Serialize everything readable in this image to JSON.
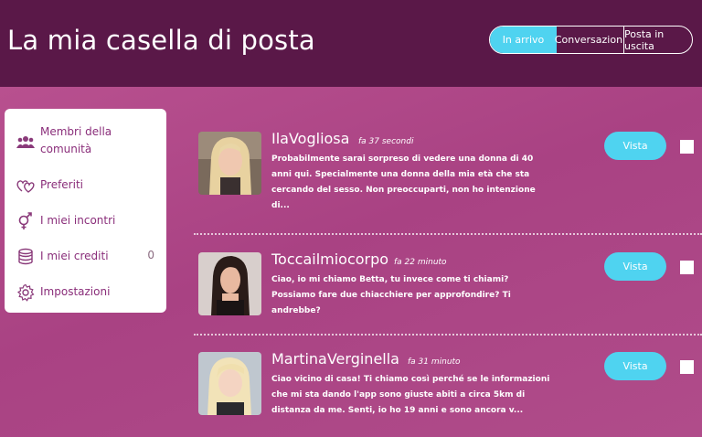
{
  "header": {
    "title": "La mia casella di posta",
    "tabs": [
      "In arrivo",
      "Conversazioni",
      "Posta in uscita"
    ]
  },
  "sidebar": {
    "items": [
      {
        "label": "Membri della comunità",
        "icon": "users-icon"
      },
      {
        "label": "Preferiti",
        "icon": "hearts-icon"
      },
      {
        "label": "I miei incontri",
        "icon": "gender-icon"
      },
      {
        "label": "I miei crediti",
        "icon": "coins-icon",
        "count": "0"
      },
      {
        "label": "Impostazioni",
        "icon": "gear-icon"
      }
    ]
  },
  "messages": [
    {
      "name": "IlaVogliosa",
      "time": "fa 37 secondi",
      "preview": "Probabilmente sarai sorpreso di vedere una donna di 40 anni qui. Specialmente una donna della mia età che sta cercando del sesso. Non preoccuparti, non ho intenzione di...",
      "button": "Vista"
    },
    {
      "name": "Toccailmiocorpo",
      "time": "fa 22 minuto",
      "preview": "Ciao, io mi chiamo Betta, tu invece come ti chiami? Possiamo fare due chiacchiere per approfondire? Ti andrebbe?",
      "button": "Vista"
    },
    {
      "name": "MartinaVerginella",
      "time": "fa 31 minuto",
      "preview": "Ciao vicino di casa! Ti chiamo così perché se le informazioni che mi sta dando l'app sono giuste abiti a circa 5km di distanza da me. Senti, io ho 19 anni e sono ancora v...",
      "button": "Vista"
    }
  ],
  "colors": {
    "header_bg": "#5a1848",
    "main_bg": "#b04a88",
    "accent": "#4fd3f0",
    "sidebar_text": "#8a2e7a"
  }
}
